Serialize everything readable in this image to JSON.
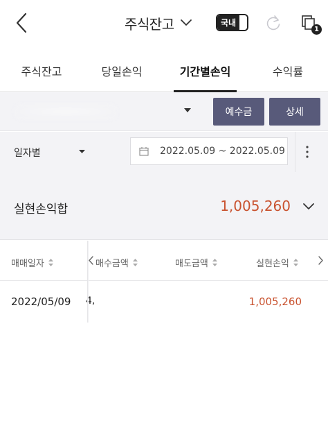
{
  "header": {
    "title": "주식잔고",
    "market_toggle": "국내",
    "notification_count": "1"
  },
  "tabs": [
    {
      "label": "주식잔고",
      "active": false
    },
    {
      "label": "당일손익",
      "active": false
    },
    {
      "label": "기간별손익",
      "active": true
    },
    {
      "label": "수익률",
      "active": false
    }
  ],
  "account": {
    "deposit_button": "예수금",
    "detail_button": "상세"
  },
  "filter": {
    "period_type": "일자별",
    "date_range": "2022.05.09 ~ 2022.05.09"
  },
  "summary": {
    "label": "실현손익합",
    "value": "1,005,260"
  },
  "table": {
    "columns": [
      "매매일자",
      "매수금액",
      "매도금액",
      "실현손익"
    ],
    "rows": [
      {
        "date": "2022/05/09",
        "buy_amount_visible": "4,",
        "profit": "1,005,260"
      }
    ]
  },
  "colors": {
    "accent_button": "#585a7a",
    "profit_red": "#c95330",
    "background_gray": "#f3f3f6"
  },
  "icons": [
    "back-chevron-icon",
    "chevron-down-icon",
    "refresh-icon",
    "copy-icon",
    "calendar-icon",
    "kebab-menu-icon",
    "sort-icon",
    "arrow-left-icon",
    "arrow-right-icon"
  ]
}
